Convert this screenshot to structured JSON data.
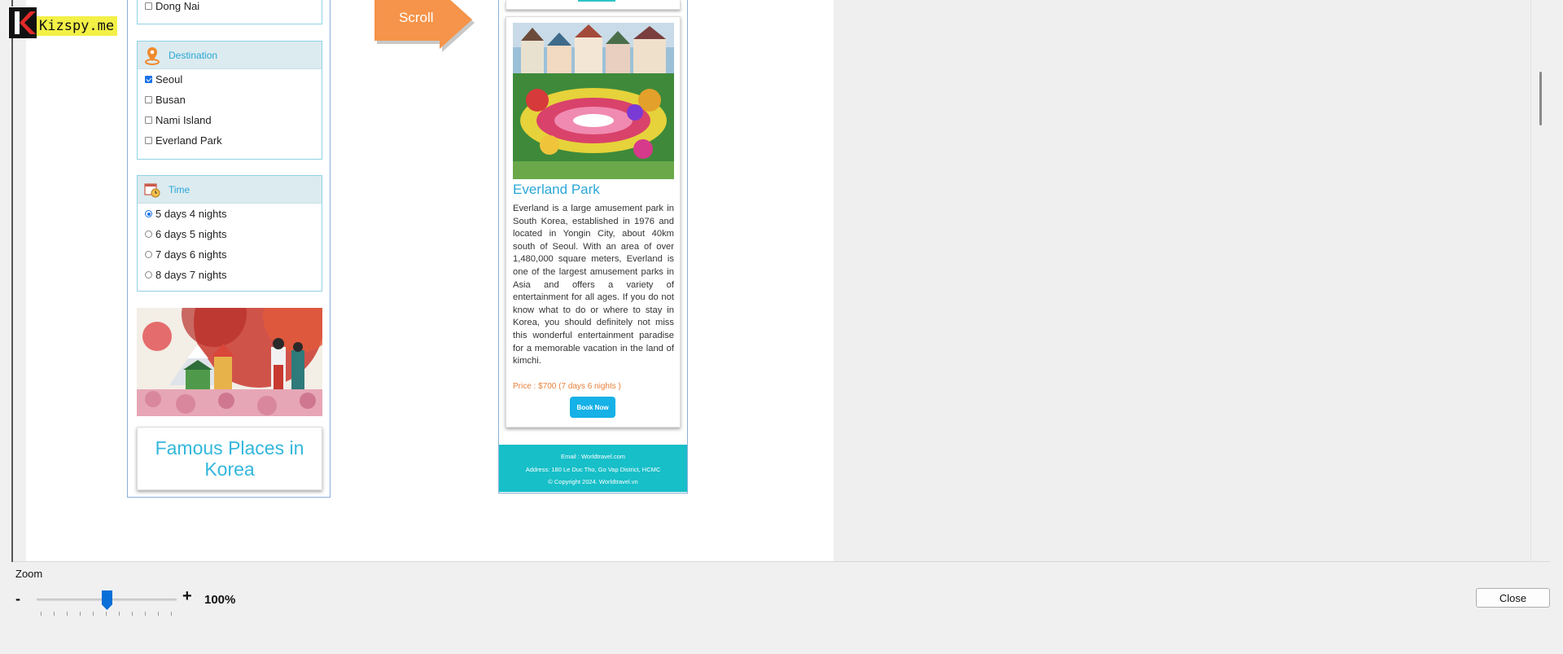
{
  "watermark": {
    "text": "Kizspy.me"
  },
  "filters": {
    "region_last_item": "Dong Nai",
    "destination": {
      "title": "Destination",
      "options": [
        {
          "label": "Seoul",
          "checked": true
        },
        {
          "label": "Busan",
          "checked": false
        },
        {
          "label": "Nami Island",
          "checked": false
        },
        {
          "label": "Everland Park",
          "checked": false
        }
      ]
    },
    "time": {
      "title": "Time",
      "options": [
        {
          "label": "5 days 4 nights",
          "selected": true
        },
        {
          "label": "6 days 5 nights",
          "selected": false
        },
        {
          "label": "7 days 6 nights",
          "selected": false
        },
        {
          "label": "8 days 7 nights",
          "selected": false
        }
      ]
    }
  },
  "promo_banner_text": "Famous Places in Korea",
  "arrow_label": "Scroll",
  "card": {
    "title": "Everland Park",
    "description": "Everland is a large amusement park in South Korea, established in 1976 and located in Yongin City, about 40km south of Seoul. With an area of over 1,480,000 square meters, Everland is one of the largest amusement parks in Asia and offers a variety of entertainment for all ages. If you do not know what to do or where to stay in Korea, you should definitely not miss this wonderful entertainment paradise for a memorable vacation in the land of kimchi.",
    "price": "Price : $700 (7 days 6 nights )",
    "book_button": "Book Now"
  },
  "footer": {
    "email": "Email : Worldtravel.com",
    "address": "Address: 180 Le Duc Tho, Go Vap District, HCMC",
    "copyright": "© Copyright 2024. Worldtravel.vn"
  },
  "zoom": {
    "label": "Zoom",
    "minus": "-",
    "plus": "+",
    "value": "100%",
    "slider_fraction": 0.5
  },
  "close_button": "Close",
  "colors": {
    "accent": "#2aa7d6",
    "footer": "#17bfc8",
    "arrow": "#f5944a",
    "slider": "#0a6fd8"
  }
}
